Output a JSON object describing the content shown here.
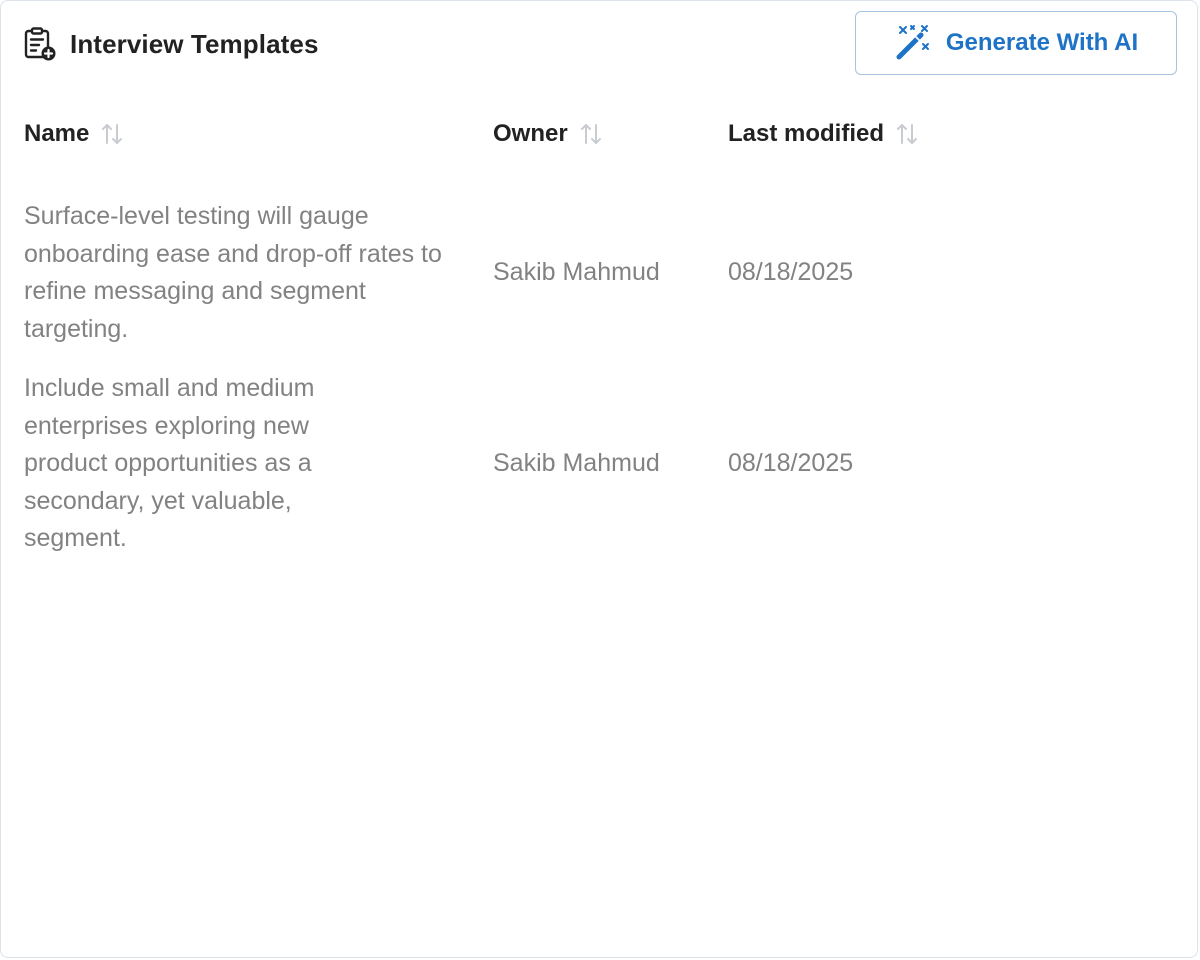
{
  "header": {
    "title": "Interview Templates",
    "icon": "clipboard-add-icon"
  },
  "actions": {
    "generate_label": "Generate With AI",
    "generate_icon": "magic-wand-icon",
    "accent_color": "#1e73c6"
  },
  "table": {
    "columns": [
      {
        "label": "Name",
        "sort_icon": "sort-icon"
      },
      {
        "label": "Owner",
        "sort_icon": "sort-icon"
      },
      {
        "label": "Last modified",
        "sort_icon": "sort-icon"
      }
    ],
    "rows": [
      {
        "name": "Surface-level testing will gauge onboarding ease and drop-off rates to refine messaging and segment targeting.",
        "owner": "Sakib Mahmud",
        "last_modified": "08/18/2025"
      },
      {
        "name": "Include small and medium enterprises exploring new product opportunities as a secondary, yet valuable, segment.",
        "owner": "Sakib Mahmud",
        "last_modified": "08/18/2025"
      }
    ]
  }
}
